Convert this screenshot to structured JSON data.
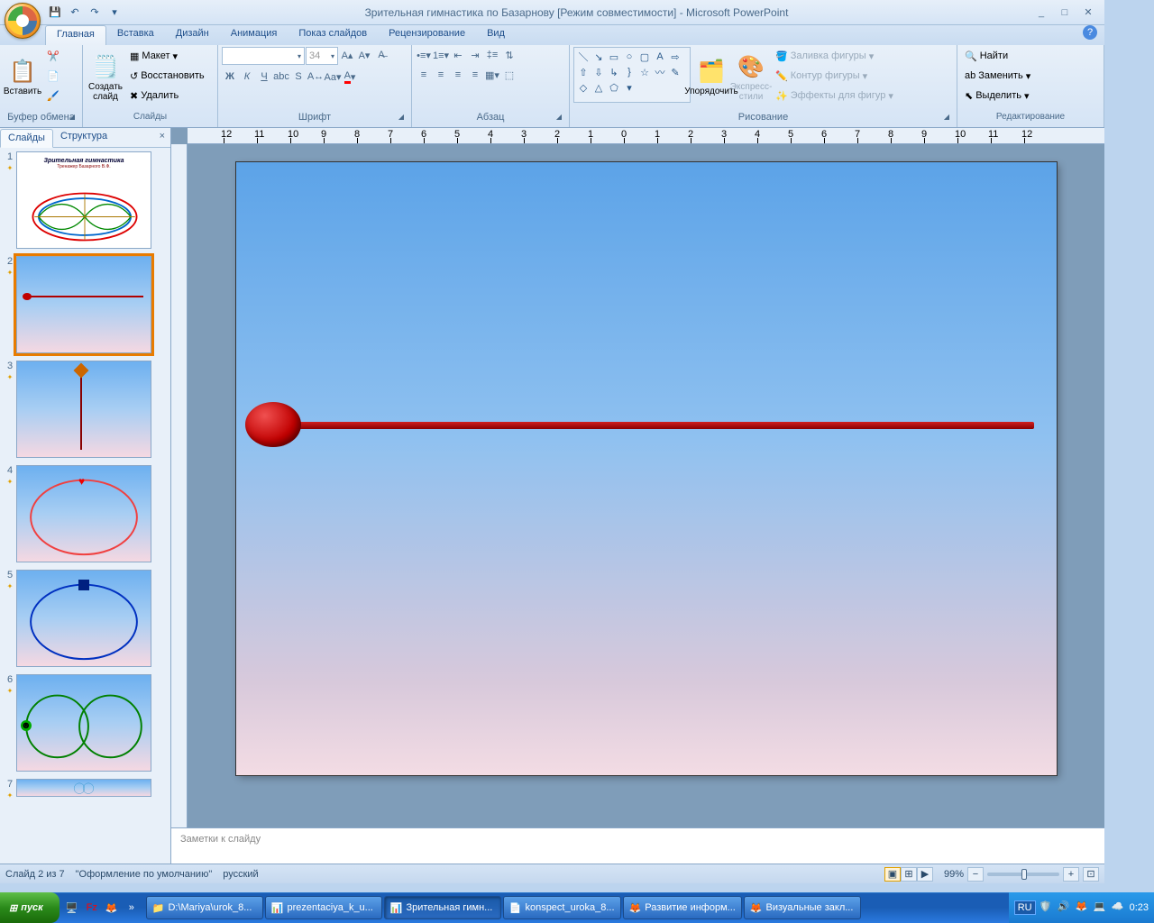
{
  "app_title": "Зрительная гимнастика по Базарнову [Режим совместимости] - Microsoft PowerPoint",
  "qat": {
    "save": "💾",
    "undo": "↶",
    "redo": "↷"
  },
  "tabs": [
    "Главная",
    "Вставка",
    "Дизайн",
    "Анимация",
    "Показ слайдов",
    "Рецензирование",
    "Вид"
  ],
  "ribbon": {
    "clipboard": {
      "label": "Буфер обмена",
      "paste": "Вставить"
    },
    "slides": {
      "label": "Слайды",
      "new": "Создать\nслайд",
      "layout": "Макет",
      "reset": "Восстановить",
      "delete": "Удалить"
    },
    "font": {
      "label": "Шрифт",
      "size": "34"
    },
    "paragraph": {
      "label": "Абзац"
    },
    "drawing": {
      "label": "Рисование",
      "arrange": "Упорядочить",
      "quick": "Экспресс-стили",
      "fill": "Заливка фигуры",
      "outline": "Контур фигуры",
      "effects": "Эффекты для фигур"
    },
    "editing": {
      "label": "Редактирование",
      "find": "Найти",
      "replace": "Заменить",
      "select": "Выделить"
    }
  },
  "sidepane": {
    "tab_slides": "Слайды",
    "tab_outline": "Структура"
  },
  "thumbs": [
    {
      "n": "1",
      "title": "Зрительная гимнастика",
      "sub": "Тренажер Базарного В.Ф."
    },
    {
      "n": "2"
    },
    {
      "n": "3"
    },
    {
      "n": "4"
    },
    {
      "n": "5"
    },
    {
      "n": "6"
    },
    {
      "n": "7"
    }
  ],
  "notes_placeholder": "Заметки к слайду",
  "status": {
    "slide": "Слайд 2 из 7",
    "theme": "\"Оформление по умолчанию\"",
    "lang": "русский",
    "zoom": "99%"
  },
  "taskbar": {
    "start": "пуск",
    "items": [
      {
        "icon": "📁",
        "label": "D:\\Mariya\\urok_8..."
      },
      {
        "icon": "📊",
        "label": "prezentaciya_k_u..."
      },
      {
        "icon": "📊",
        "label": "Зрительная гимн...",
        "active": true
      },
      {
        "icon": "📄",
        "label": "konspect_uroka_8..."
      },
      {
        "icon": "🦊",
        "label": "Развитие информ..."
      },
      {
        "icon": "🦊",
        "label": "Визуальные закл..."
      }
    ],
    "lang": "RU",
    "time": "0:23"
  }
}
